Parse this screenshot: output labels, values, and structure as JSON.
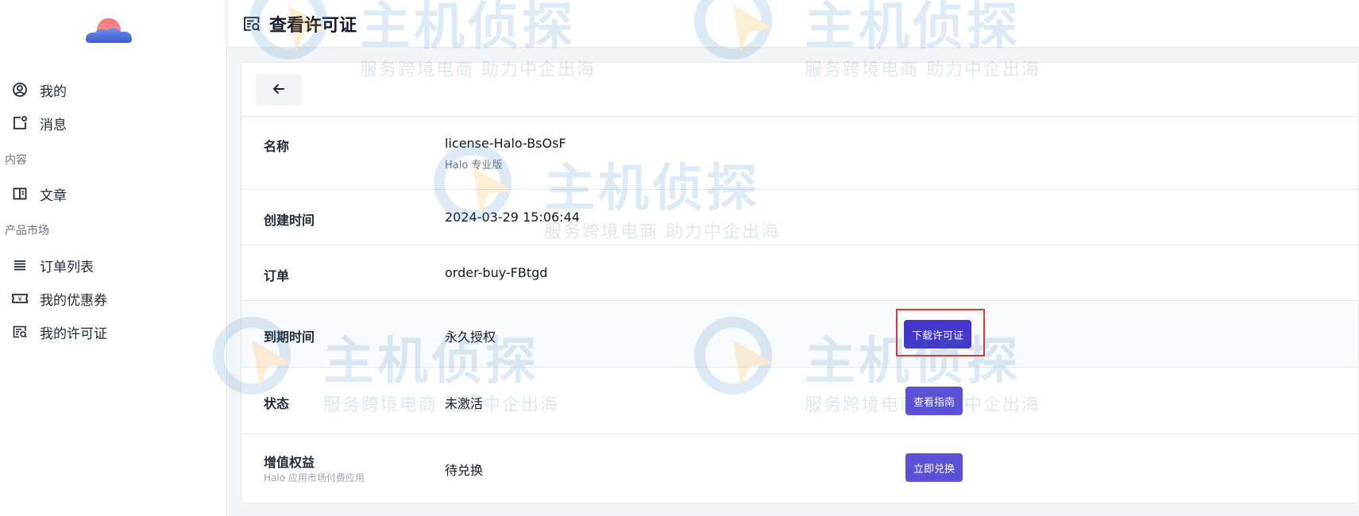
{
  "sidebar": {
    "items_top": [
      {
        "label": "我的",
        "icon": "user-circle-icon"
      },
      {
        "label": "消息",
        "icon": "message-icon"
      }
    ],
    "group_content": "内容",
    "items_content": [
      {
        "label": "文章",
        "icon": "book-icon"
      }
    ],
    "group_market": "产品市场",
    "items_market": [
      {
        "label": "订单列表",
        "icon": "list-icon"
      },
      {
        "label": "我的优惠券",
        "icon": "coupon-icon"
      },
      {
        "label": "我的许可证",
        "icon": "license-icon"
      }
    ]
  },
  "header": {
    "title": "查看许可证",
    "icon": "license-icon"
  },
  "detail": {
    "back_icon": "arrow-left-icon",
    "rows": [
      {
        "key": "名称",
        "value": "license-Halo-BsOsF",
        "value_sub": "Halo 专业版"
      },
      {
        "key": "创建时间",
        "value": "2024-03-29 15:06:44"
      },
      {
        "key": "订单",
        "value": "order-buy-FBtgd"
      },
      {
        "key": "到期时间",
        "value": "永久授权",
        "button": "下载许可证"
      },
      {
        "key": "状态",
        "value": "未激活",
        "button": "查看指南"
      },
      {
        "key": "增值权益",
        "key_sub": "Halo 应用市场付费应用",
        "value": "待兑换",
        "button": "立即兑换"
      }
    ]
  },
  "watermark": {
    "main": "主机侦探",
    "sub": "服务跨境电商 助力中企出海"
  },
  "colors": {
    "accent": "#5b50d6",
    "accent_dark": "#4338ca",
    "highlight": "#d83a2e",
    "watermark": "#3b82c4"
  }
}
